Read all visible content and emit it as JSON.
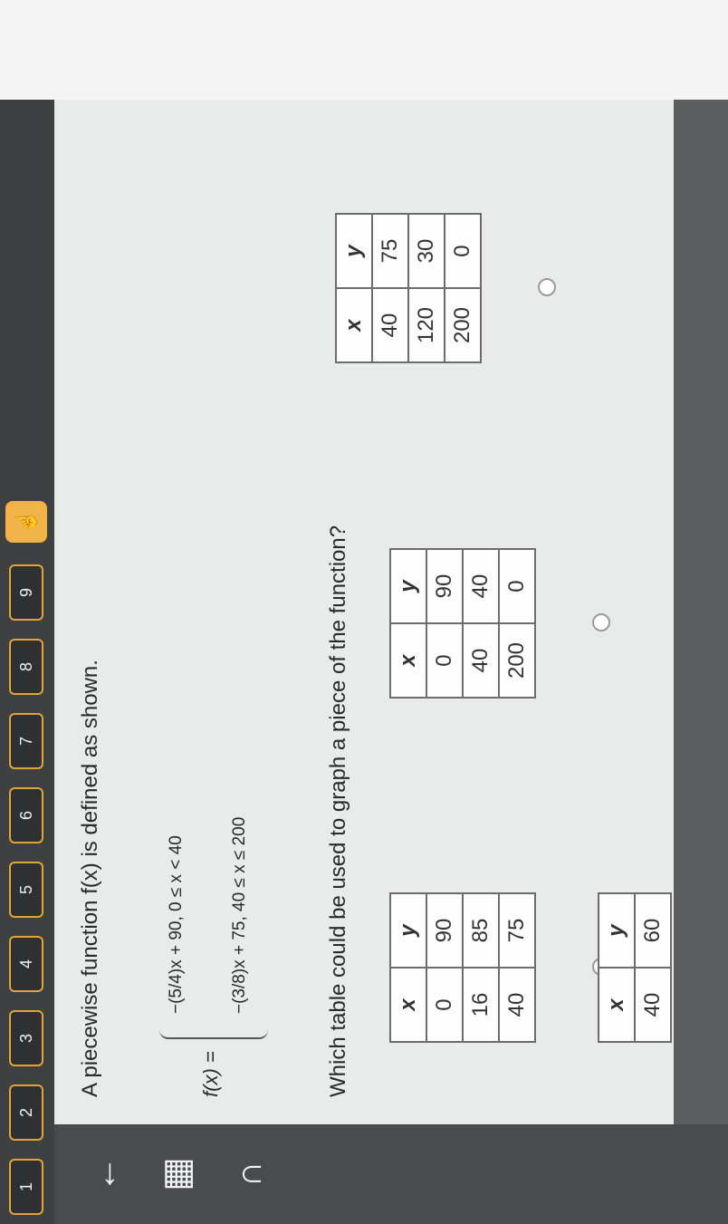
{
  "nav": {
    "buttons": [
      "1",
      "2",
      "3",
      "4",
      "5",
      "6",
      "7",
      "8",
      "9"
    ],
    "hint_icon": "hand-pointer-icon"
  },
  "tools": {
    "icons": [
      "back-arrow-icon",
      "calculator-icon",
      "headphones-icon"
    ]
  },
  "question": {
    "prompt": "A piecewise function f(x) is defined as shown.",
    "fx": "f(x) =",
    "piece1": "−(5/4)x + 90,   0 ≤ x < 40",
    "piece2": "−(3/8)x + 75,   40 ≤ x ≤ 200",
    "text": "Which table could be used to graph a piece of the function?"
  },
  "choices": [
    {
      "headers": [
        "x",
        "y"
      ],
      "rows": [
        [
          "0",
          "90"
        ],
        [
          "16",
          "85"
        ],
        [
          "40",
          "75"
        ]
      ]
    },
    {
      "headers": [
        "x",
        "y"
      ],
      "rows": [
        [
          "0",
          "90"
        ],
        [
          "40",
          "40"
        ],
        [
          "200",
          "0"
        ]
      ]
    },
    {
      "headers": [
        "x",
        "y"
      ],
      "rows": [
        [
          "40",
          "75"
        ],
        [
          "120",
          "30"
        ],
        [
          "200",
          "0"
        ]
      ]
    },
    {
      "headers": [
        "x",
        "y"
      ],
      "rows": [
        [
          "40",
          "60"
        ]
      ]
    }
  ],
  "taskbar": {
    "apps": [
      "chrome-icon",
      "paint-icon",
      "classroom-icon"
    ]
  }
}
